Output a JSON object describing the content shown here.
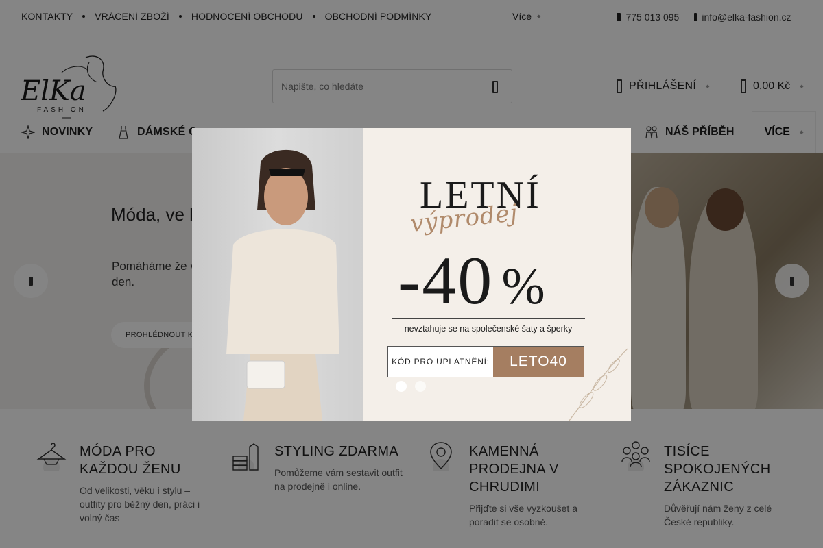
{
  "topbar": {
    "links": [
      "KONTAKTY",
      "VRÁCENÍ ZBOŽÍ",
      "HODNOCENÍ OBCHODU",
      "OBCHODNÍ PODMÍNKY"
    ],
    "more_label": "Více",
    "phone": "775 013 095",
    "email": "info@elka-fashion.cz"
  },
  "header": {
    "logo_text": "ElKa",
    "logo_sub": "FASHION",
    "search_placeholder": "Napište, co hledáte",
    "login_label": "PŘIHLÁŠENÍ",
    "cart_label": "0,00 Kč"
  },
  "nav": {
    "items": [
      "NOVINKY",
      "DÁMSKÉ O",
      "NÁŠ PŘÍBĚH"
    ],
    "more_label": "VÍCE"
  },
  "hero": {
    "title": "Móda, ve k cítit sama",
    "text": "Pomáháme že ve kterém se b každý den.",
    "button": "PROHLÉDNOUT KOL"
  },
  "popup": {
    "headline": "LETNÍ",
    "script": "výprodej",
    "discount": "-40",
    "percent": "%",
    "note": "nevztahuje se na společenské šaty a šperky",
    "code_label": "KÓD PRO UPLATNĚNÍ:",
    "code": "LETO40",
    "accent": "#a57e61"
  },
  "features": [
    {
      "title": "MÓDA PRO KAŽDOU ŽENU",
      "desc": "Od velikosti, věku i stylu – outfity pro běžný den, práci i volný čas",
      "icon": "hanger-icon"
    },
    {
      "title": "STYLING ZDARMA",
      "desc": "Pomůžeme vám sestavit outfit na prodejně i online.",
      "icon": "clothes-stack-icon"
    },
    {
      "title": "KAMENNÁ PRODEJNA V CHRUDIMI",
      "desc": "Přijďte si vše vyzkoušet a poradit se osobně.",
      "icon": "location-pin-icon"
    },
    {
      "title": "TISÍCE SPOKOJENÝCH ZÁKAZNIC",
      "desc": "Důvěřují nám ženy z celé České republiky.",
      "icon": "group-icon"
    }
  ]
}
